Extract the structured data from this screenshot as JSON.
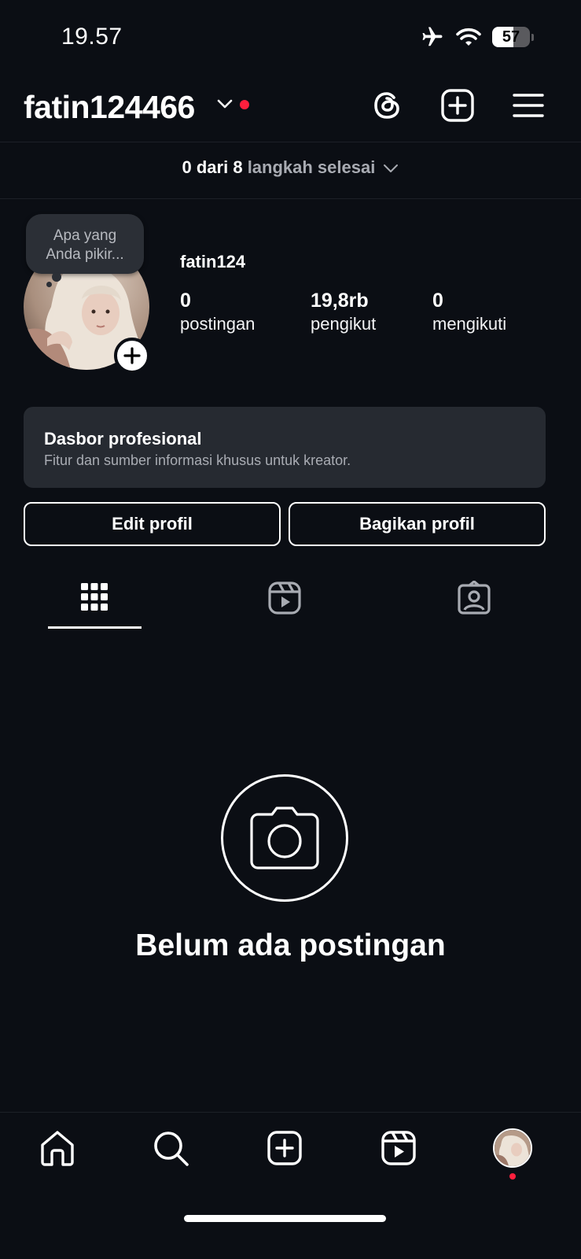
{
  "status_bar": {
    "time": "19.57",
    "battery": "57",
    "battery_level": 0.57,
    "icons": [
      "airplane-icon",
      "wifi-icon",
      "battery-icon"
    ]
  },
  "header": {
    "username": "fatin124466",
    "icons": [
      "threads-icon",
      "create-post-icon",
      "menu-icon"
    ]
  },
  "steps": {
    "done": "0 dari 8",
    "rest": "langkah selesai"
  },
  "profile": {
    "note_bubble": "Apa yang Anda pikir...",
    "note_line1": "Apa yang",
    "note_line2": "Anda pikir...",
    "display_name": "fatin124",
    "stats": [
      {
        "value": "0",
        "label": "postingan"
      },
      {
        "value": "19,8rb",
        "label": "pengikut"
      },
      {
        "value": "0",
        "label": "mengikuti"
      }
    ]
  },
  "dashboard": {
    "title": "Dasbor profesional",
    "subtitle": "Fitur dan sumber informasi khusus untuk kreator."
  },
  "buttons": {
    "edit": "Edit profil",
    "share": "Bagikan profil"
  },
  "tabs": [
    "grid-icon",
    "reels-icon",
    "tagged-icon"
  ],
  "empty_state": {
    "text": "Belum ada postingan"
  },
  "bottom_nav": [
    "home-icon",
    "search-icon",
    "create-icon",
    "reels-icon",
    "profile-avatar"
  ],
  "colors": {
    "background": "#0b0e14",
    "card": "#262a31",
    "notification_red": "#ff1f3d",
    "muted_text": "#a8abb2"
  }
}
